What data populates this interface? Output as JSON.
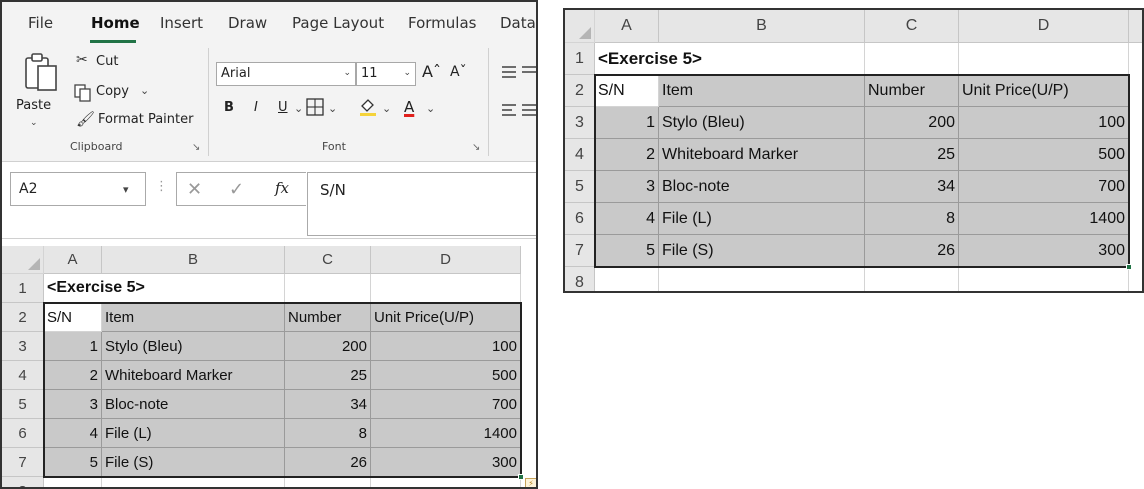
{
  "ribbon": {
    "tabs": [
      "File",
      "Home",
      "Insert",
      "Draw",
      "Page Layout",
      "Formulas",
      "Data"
    ],
    "active_tab": "Home",
    "clipboard": {
      "paste": "Paste",
      "cut": "Cut",
      "copy": "Copy",
      "format_painter": "Format Painter",
      "group_label": "Clipboard"
    },
    "font": {
      "font_name": "Arial",
      "font_size": "11",
      "bold": "B",
      "italic": "I",
      "underline": "U",
      "font_color_glyph": "A",
      "group_label": "Font"
    }
  },
  "formula_bar": {
    "name_box": "A2",
    "fx": "fx",
    "formula": "S/N"
  },
  "sheet": {
    "columns": [
      "A",
      "B",
      "C",
      "D"
    ],
    "rows": [
      "1",
      "2",
      "3",
      "4",
      "5",
      "6",
      "7",
      "8"
    ],
    "title": "<Exercise 5>",
    "headers": [
      "S/N",
      "Item",
      "Number",
      "Unit Price(U/P)"
    ],
    "data": [
      [
        "1",
        "Stylo (Bleu)",
        "200",
        "100"
      ],
      [
        "2",
        "Whiteboard Marker",
        "25",
        "500"
      ],
      [
        "3",
        "Bloc-note",
        "34",
        "700"
      ],
      [
        "4",
        "File (L)",
        "8",
        "1400"
      ],
      [
        "5",
        "File (S)",
        "26",
        "300"
      ]
    ]
  },
  "colors": {
    "accent": "#217346",
    "table_fill": "#c9c9c9",
    "font_color_underline": "#e0201c"
  }
}
